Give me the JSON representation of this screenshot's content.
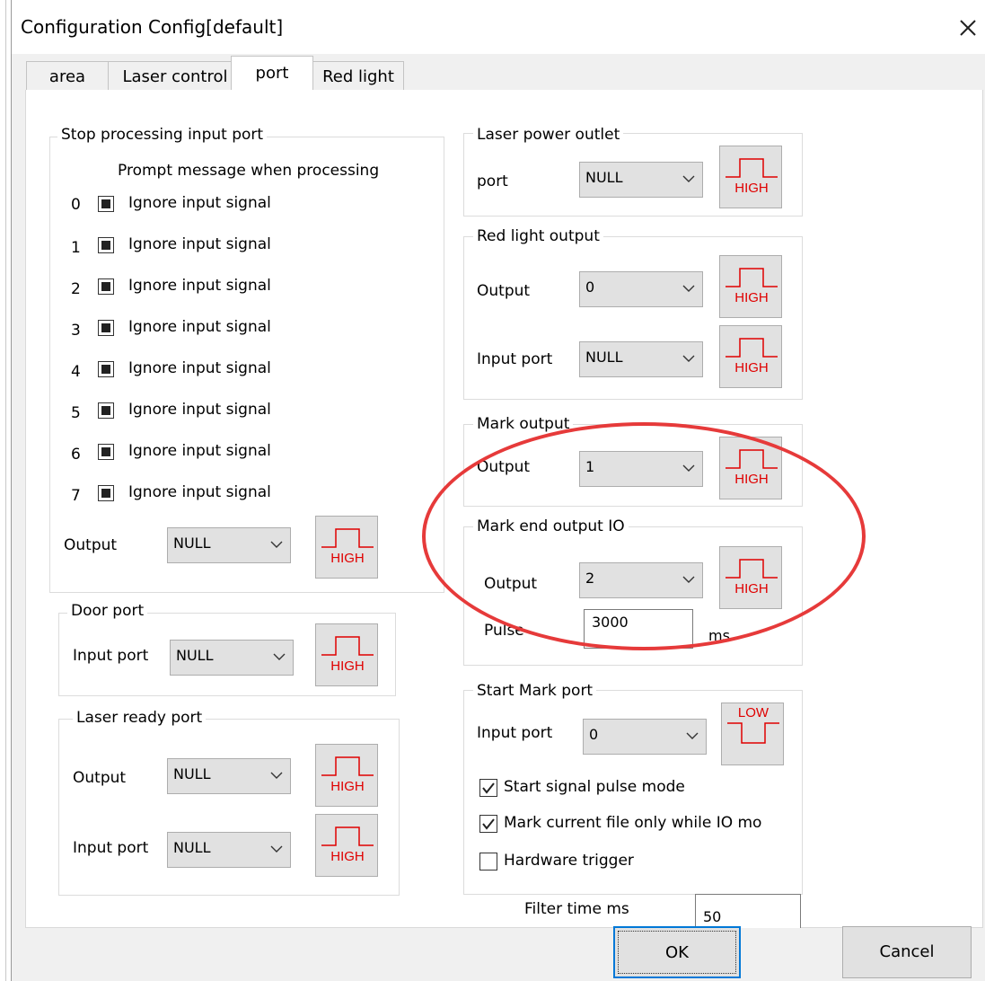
{
  "window": {
    "title": "Configuration Config[default]"
  },
  "tabs": [
    {
      "label": "area",
      "active": false
    },
    {
      "label": "Laser control",
      "active": false
    },
    {
      "label": "port",
      "active": true
    },
    {
      "label": "Red light",
      "active": false
    }
  ],
  "stop_processing": {
    "title": "Stop processing input port",
    "prompt": "Prompt message when processing",
    "rows": [
      {
        "num": "0",
        "label": "Ignore input signal"
      },
      {
        "num": "1",
        "label": "Ignore input signal"
      },
      {
        "num": "2",
        "label": "Ignore input signal"
      },
      {
        "num": "3",
        "label": "Ignore input signal"
      },
      {
        "num": "4",
        "label": "Ignore input signal"
      },
      {
        "num": "5",
        "label": "Ignore input signal"
      },
      {
        "num": "6",
        "label": "Ignore input signal"
      },
      {
        "num": "7",
        "label": "Ignore input signal"
      }
    ],
    "output_label": "Output",
    "output_value": "NULL",
    "output_signal": "HIGH"
  },
  "door_port": {
    "title": "Door port",
    "input_label": "Input port",
    "input_value": "NULL",
    "signal": "HIGH"
  },
  "laser_ready": {
    "title": "Laser ready port",
    "output_label": "Output",
    "output_value": "NULL",
    "output_signal": "HIGH",
    "input_label": "Input port",
    "input_value": "NULL",
    "input_signal": "HIGH"
  },
  "laser_power": {
    "title": "Laser power outlet",
    "port_label": "port",
    "port_value": "NULL",
    "signal": "HIGH"
  },
  "red_light_output": {
    "title": "Red light output",
    "output_label": "Output",
    "output_value": "0",
    "output_signal": "HIGH",
    "input_label": "Input port",
    "input_value": "NULL",
    "input_signal": "HIGH"
  },
  "mark_output": {
    "title": "Mark output",
    "output_label": "Output",
    "output_value": "1",
    "signal": "HIGH"
  },
  "mark_end": {
    "title": "Mark end output IO",
    "output_label": "Output",
    "output_value": "2",
    "signal": "HIGH",
    "pulse_label": "Pulse",
    "pulse_value": "3000",
    "pulse_unit": "ms"
  },
  "start_mark": {
    "title": "Start Mark port",
    "input_label": "Input port",
    "input_value": "0",
    "signal": "LOW",
    "checkboxes": [
      {
        "label": "Start signal pulse mode",
        "checked": true
      },
      {
        "label": "Mark current file only while IO mo",
        "checked": true
      },
      {
        "label": "Hardware trigger",
        "checked": false
      }
    ]
  },
  "filter": {
    "label": "Filter time ms",
    "value": "50"
  },
  "buttons": {
    "ok": "OK",
    "cancel": "Cancel"
  },
  "annotation_color": "#e63a3a",
  "signal_color": "#e00000"
}
